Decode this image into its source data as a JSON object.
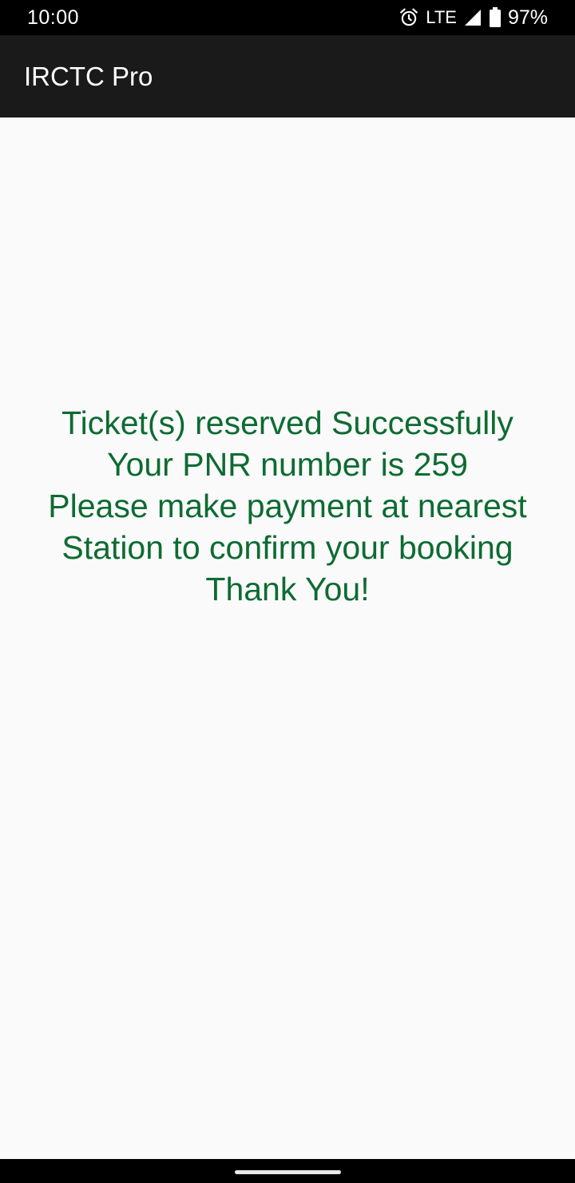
{
  "status_bar": {
    "time": "10:00",
    "network": "LTE",
    "battery": "97%",
    "icons": [
      "alarm-icon",
      "signal-icon",
      "battery-icon"
    ]
  },
  "app_bar": {
    "title": "IRCTC Pro"
  },
  "message": {
    "lines": [
      "Ticket(s) reserved Successfully",
      "Your PNR number is 259",
      "Please make payment at nearest",
      "Station to confirm your booking",
      "Thank You!"
    ],
    "color": "#0d6b32"
  },
  "colors": {
    "status_bar": "#000000",
    "app_bar": "#1a1a1a",
    "background": "#fafafa"
  }
}
